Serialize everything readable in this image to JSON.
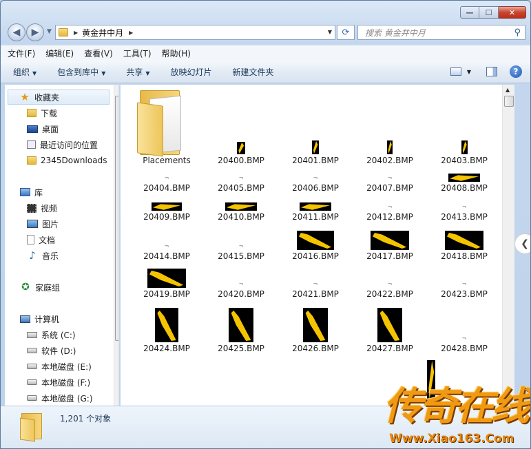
{
  "window": {
    "caption": {
      "min": "—",
      "max": "☐",
      "close": "✕"
    }
  },
  "address_bar": {
    "path": "黄金井中月",
    "search_placeholder": "搜索 黄金井中月"
  },
  "menu": [
    "文件(F)",
    "编辑(E)",
    "查看(V)",
    "工具(T)",
    "帮助(H)"
  ],
  "toolbar": {
    "organize": "组织",
    "include_library": "包含到库中",
    "share": "共享",
    "slideshow": "放映幻灯片",
    "new_folder": "新建文件夹"
  },
  "nav": {
    "favorites": "收藏夹",
    "downloads": "下载",
    "desktop": "桌面",
    "recent": "最近访问的位置",
    "downloads2345": "2345Downloads",
    "libraries": "库",
    "videos": "视频",
    "pictures": "图片",
    "documents": "文档",
    "music": "音乐",
    "homegroup": "家庭组",
    "computer": "计算机",
    "drive_c": "系统 (C:)",
    "drive_d": "软件 (D:)",
    "drive_e": "本地磁盘 (E:)",
    "drive_f": "本地磁盘 (F:)",
    "drive_g": "本地磁盘 (G:)"
  },
  "files": {
    "folder": "Placements",
    "f20400": "20400.BMP",
    "f20401": "20401.BMP",
    "f20402": "20402.BMP",
    "f20403": "20403.BMP",
    "f20404": "20404.BMP",
    "f20405": "20405.BMP",
    "f20406": "20406.BMP",
    "f20407": "20407.BMP",
    "f20408": "20408.BMP",
    "f20409": "20409.BMP",
    "f20410": "20410.BMP",
    "f20411": "20411.BMP",
    "f20412": "20412.BMP",
    "f20413": "20413.BMP",
    "f20414": "20414.BMP",
    "f20415": "20415.BMP",
    "f20416": "20416.BMP",
    "f20417": "20417.BMP",
    "f20418": "20418.BMP",
    "f20419": "20419.BMP",
    "f20420": "20420.BMP",
    "f20421": "20421.BMP",
    "f20422": "20422.BMP",
    "f20423": "20423.BMP",
    "f20424": "20424.BMP",
    "f20425": "20425.BMP",
    "f20426": "20426.BMP",
    "f20427": "20427.BMP",
    "f20428": "20428.BMP"
  },
  "status": {
    "count": "1,201 个对象"
  },
  "watermark": {
    "text": "传奇在线",
    "url": "Www.Xiao163.Com"
  },
  "colors": {
    "sword_gold": "#f5c400",
    "thumb_bg": "#000000",
    "watermark_orange": "#f09a13"
  }
}
